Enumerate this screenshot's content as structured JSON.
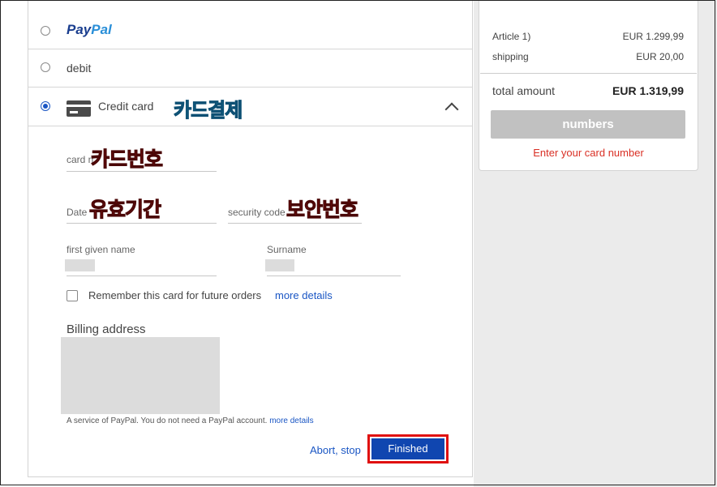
{
  "payment_methods": {
    "paypal": {
      "logo_part1": "Pay",
      "logo_part2": "Pal"
    },
    "debit": {
      "label": "debit"
    },
    "credit_card": {
      "label": "Credit card",
      "annotation_ko": "카드결제"
    }
  },
  "form": {
    "card_number": {
      "label": "card n",
      "annotation_ko": "카드번호"
    },
    "date": {
      "label": "Date",
      "annotation_ko": "유효기간"
    },
    "security_code": {
      "label": "security code",
      "annotation_ko": "보안번호"
    },
    "first_name": {
      "label": "first given name"
    },
    "surname": {
      "label": "Surname"
    },
    "remember": {
      "label": "Remember this card for future orders",
      "link": "more details"
    },
    "billing_address": {
      "label": "Billing address"
    },
    "service_note": {
      "text": "A service of PayPal. You do not need a PayPal account.",
      "link": "more details"
    },
    "abort_label": "Abort, stop",
    "finish_label": "Finished"
  },
  "summary": {
    "article_label": "Article 1)",
    "article_value": "EUR 1.299,99",
    "shipping_label": "shipping",
    "shipping_value": "EUR 20,00",
    "total_label": "total amount",
    "total_value": "EUR 1.319,99",
    "numbers_button": "numbers",
    "error_text": "Enter your card number"
  },
  "icons": [
    "radio-icon",
    "credit-card-icon",
    "chevron-up-icon",
    "checkbox-icon"
  ],
  "colors": {
    "accent": "#1a56c4",
    "finish_button": "#1046b0",
    "highlight": "#e01010",
    "error": "#d93025"
  }
}
